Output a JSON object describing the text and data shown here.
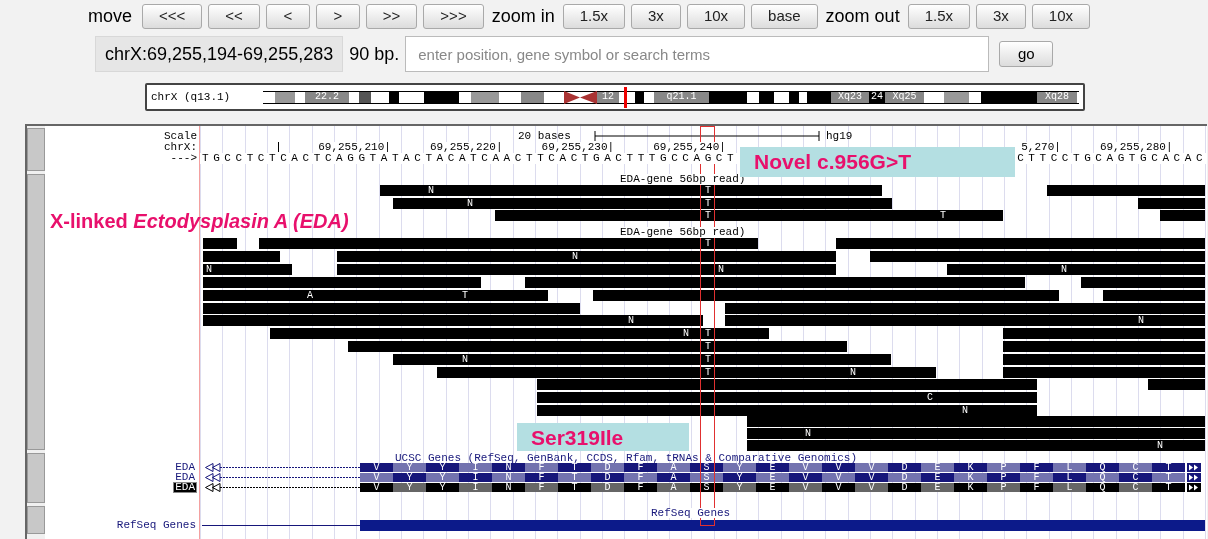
{
  "nav": {
    "move_label": "move",
    "move_buttons": [
      "<<<",
      "<<",
      "<",
      ">",
      ">>",
      ">>>"
    ],
    "zoom_in_label": "zoom in",
    "zoom_in_buttons": [
      "1.5x",
      "3x",
      "10x",
      "base"
    ],
    "zoom_out_label": "zoom out",
    "zoom_out_buttons": [
      "1.5x",
      "3x",
      "10x"
    ]
  },
  "position": {
    "value": "chrX:69,255,194-69,255,283",
    "size": "90 bp.",
    "search_placeholder": "enter position, gene symbol or search terms",
    "go_button": "go"
  },
  "ideogram": {
    "label": "chrX (q13.1)",
    "band_labels": [
      "22.2",
      "12",
      "q21.1",
      "Xq23",
      "24",
      "Xq25",
      "Xq28"
    ]
  },
  "ruler": {
    "scale_label": "Scale",
    "scale_bar": "20 bases",
    "assembly": "hg19",
    "chrom_label": "chrX:",
    "ticks": [
      "69,255,210|",
      "69,255,220|",
      "69,255,230|",
      "69,255,240|",
      "5,270|",
      "69,255,280|"
    ],
    "strand": "--->",
    "sequence_left": "TGCCTCTCACTCAGGTATACTACATCAACTTCACTGACTTTGCCAGCT",
    "sequence_right": "CTTCCTGCAGTGCACAC"
  },
  "annotations": [
    {
      "kind": "boxed",
      "text": "Novel c.956G>T"
    },
    {
      "kind": "plain",
      "text": "X-linked *Ectodysplasin A (EDA)*"
    },
    {
      "kind": "boxed",
      "text": "Ser319Ile"
    }
  ],
  "read_groups": [
    {
      "label": "EDA-gene 56bp read)",
      "marks": [
        "N",
        "T",
        "N",
        "T",
        "T",
        "T"
      ]
    },
    {
      "label": "EDA-gene 56bp read)",
      "marks": [
        "T",
        "N",
        "N",
        "N",
        "N",
        "A",
        "T",
        "N",
        "N",
        "N",
        "T",
        "T",
        "N",
        "T",
        "T",
        "N",
        "C",
        "N",
        "N",
        "N"
      ]
    }
  ],
  "genes": {
    "title": "UCSC Genes (RefSeq, GenBank, CCDS, Rfam, tRNAs & Comparative Genomics)",
    "rows": [
      {
        "name": "EDA",
        "selected": false,
        "color": "#16167a",
        "amino_acids": [
          "V",
          "Y",
          "Y",
          "I",
          "N",
          "F",
          "T",
          "D",
          "F",
          "A",
          "S",
          "Y",
          "E",
          "V",
          "V",
          "V",
          "D",
          "E",
          "K",
          "P",
          "F",
          "L",
          "Q",
          "C",
          "T"
        ]
      },
      {
        "name": "EDA",
        "selected": false,
        "color": "#16167a",
        "amino_acids": [
          "V",
          "Y",
          "Y",
          "I",
          "N",
          "F",
          "T",
          "D",
          "F",
          "A",
          "S",
          "Y",
          "E",
          "V",
          "V",
          "V",
          "D",
          "E",
          "K",
          "P",
          "F",
          "L",
          "Q",
          "C",
          "T"
        ]
      },
      {
        "name": "EDA",
        "selected": true,
        "color": "#000000",
        "amino_acids": [
          "V",
          "Y",
          "Y",
          "I",
          "N",
          "F",
          "T",
          "D",
          "F",
          "A",
          "S",
          "Y",
          "E",
          "V",
          "V",
          "V",
          "D",
          "E",
          "K",
          "P",
          "F",
          "L",
          "Q",
          "C",
          "T"
        ]
      }
    ]
  },
  "refseq": {
    "title": "RefSeq Genes",
    "label": "RefSeq Genes"
  }
}
